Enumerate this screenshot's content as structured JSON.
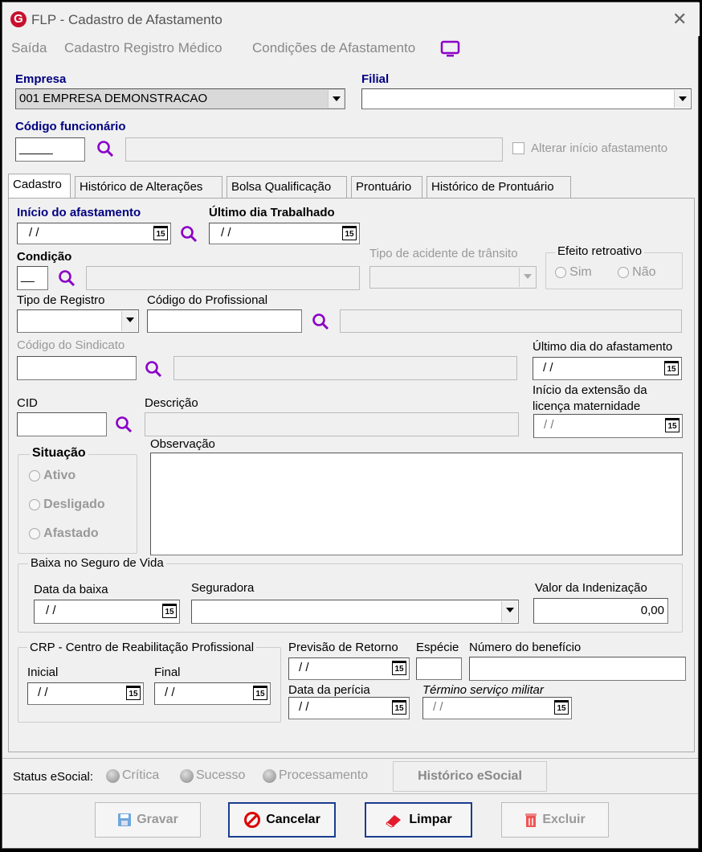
{
  "window": {
    "title": "FLP - Cadastro de Afastamento",
    "logo_letter": "G"
  },
  "menu": {
    "items": [
      "Saída",
      "Cadastro Registro Médico",
      "Condições de Afastamento"
    ]
  },
  "empresa": {
    "label": "Empresa",
    "value": "001 EMPRESA DEMONSTRACAO"
  },
  "filial": {
    "label": "Filial",
    "value": ""
  },
  "funcionario": {
    "label": "Código funcionário",
    "code": "_____",
    "alterar_label": "Alterar início afastamento"
  },
  "tabs": [
    "Cadastro",
    "Histórico de Alterações",
    "Bolsa Qualificação",
    "Prontuário",
    "Histórico de Prontuário"
  ],
  "cadastro": {
    "inicio_label": "Início do afastamento",
    "inicio_value": "/ /",
    "ultimo_trab_label": "Último dia Trabalhado",
    "ultimo_trab_value": "/ /",
    "condicao_label": "Condição",
    "condicao_code": "__",
    "tipo_acidente_label": "Tipo de acidente de trânsito",
    "efeito_label": "Efeito retroativo",
    "efeito_sim": "Sim",
    "efeito_nao": "Não",
    "tipo_registro_label": "Tipo de Registro",
    "codigo_prof_label": "Código do Profissional",
    "codigo_sind_label": "Código do Sindicato",
    "ultimo_afast_label": "Último dia do afastamento",
    "ultimo_afast_value": "/ /",
    "cid_label": "CID",
    "descricao_label": "Descrição",
    "ext_label_1": "Início da extensão da",
    "ext_label_2": "licença maternidade",
    "ext_value": "/ /",
    "situacao_label": "Situação",
    "situacao_opts": [
      "Ativo",
      "Desligado",
      "Afastado"
    ],
    "observacao_label": "Observação",
    "baixa_label": "Baixa no Seguro de Vida",
    "data_baixa_label": "Data da baixa",
    "data_baixa_value": "/ /",
    "seguradora_label": "Seguradora",
    "valor_label": "Valor da Indenização",
    "valor_value": "0,00",
    "crp_label": "CRP - Centro de Reabilitação Profissional",
    "inicial_label": "Inicial",
    "inicial_value": "/ /",
    "final_label": "Final",
    "final_value": "/ /",
    "previsao_label": "Previsão de Retorno",
    "previsao_value": "/ /",
    "especie_label": "Espécie",
    "numero_label": "Número do benefício",
    "pericia_label": "Data da perícia",
    "pericia_value": "/ /",
    "termino_label": "Término serviço militar",
    "termino_value": "/ /"
  },
  "status": {
    "label": "Status eSocial:",
    "items": [
      "Crítica",
      "Sucesso",
      "Processamento"
    ],
    "historico": "Histórico eSocial"
  },
  "buttons": {
    "gravar": "Gravar",
    "cancelar": "Cancelar",
    "limpar": "Limpar",
    "excluir": "Excluir"
  },
  "calendar_glyph": "15"
}
